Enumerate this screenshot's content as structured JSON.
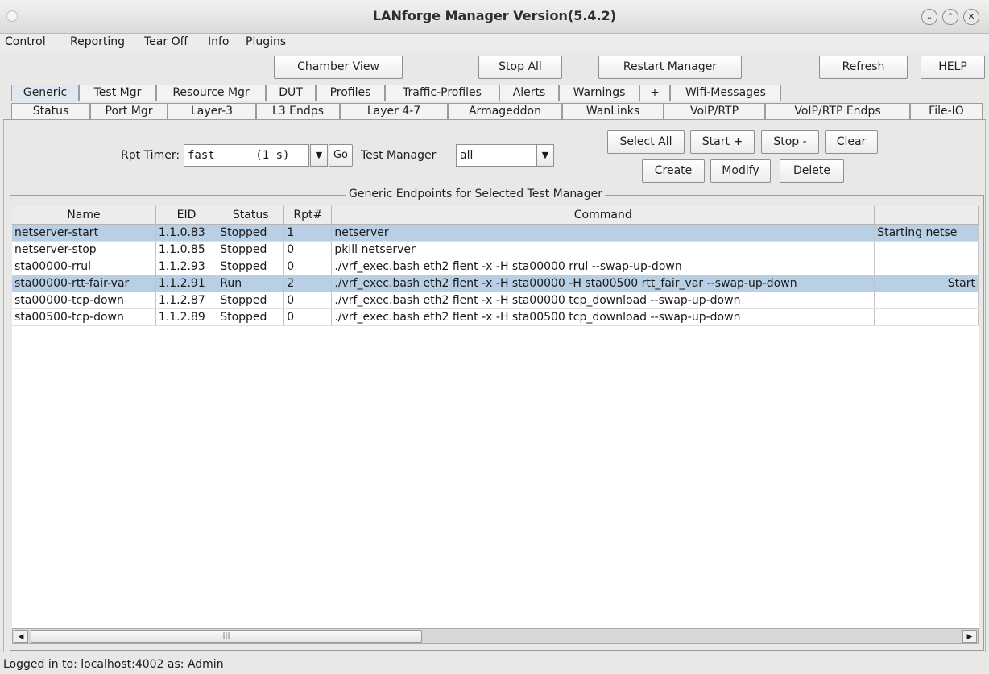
{
  "window": {
    "title": "LANforge Manager   Version(5.4.2)",
    "controls": [
      "minimize-icon",
      "maximize-icon",
      "close-icon"
    ]
  },
  "menu": [
    "Control",
    "Reporting",
    "Tear Off",
    "Info",
    "Plugins"
  ],
  "toolbar": {
    "chamber_view": "Chamber View",
    "stop_all": "Stop All",
    "restart_manager": "Restart Manager",
    "refresh": "Refresh",
    "help": "HELP"
  },
  "tabs_row1": [
    "Generic",
    "Test Mgr",
    "Resource Mgr",
    "DUT",
    "Profiles",
    "Traffic-Profiles",
    "Alerts",
    "Warnings",
    "+",
    "Wifi-Messages"
  ],
  "tabs_row2": [
    "Status",
    "Port Mgr",
    "Layer-3",
    "L3 Endps",
    "Layer 4-7",
    "Armageddon",
    "WanLinks",
    "VoIP/RTP",
    "VoIP/RTP Endps",
    "File-IO"
  ],
  "selected_tab": "Generic",
  "controls": {
    "rpt_timer_label": "Rpt Timer:",
    "rpt_timer_value": "fast      (1 s)",
    "go": "Go",
    "test_manager_label": "Test Manager",
    "test_manager_value": "all",
    "select_all": "Select All",
    "start": "Start +",
    "stop": "Stop -",
    "clear": "Clear",
    "create": "Create",
    "modify": "Modify",
    "delete": "Delete"
  },
  "group_title": "Generic Endpoints for Selected Test Manager",
  "table": {
    "columns": [
      "Name",
      "EID",
      "Status",
      "Rpt#",
      "Command",
      ""
    ],
    "rows": [
      {
        "name": "netserver-start",
        "eid": "1.1.0.83",
        "status": "Stopped",
        "rpt": "1",
        "command": "netserver",
        "extra": "Starting netse",
        "selected": true
      },
      {
        "name": "netserver-stop",
        "eid": "1.1.0.85",
        "status": "Stopped",
        "rpt": "0",
        "command": "pkill netserver",
        "extra": "",
        "selected": false
      },
      {
        "name": "sta00000-rrul",
        "eid": "1.1.2.93",
        "status": "Stopped",
        "rpt": "0",
        "command": "./vrf_exec.bash eth2 flent -x -H sta00000 rrul --swap-up-down",
        "extra": "",
        "selected": false
      },
      {
        "name": "sta00000-rtt-fair-var",
        "eid": "1.1.2.91",
        "status": "Run",
        "rpt": "2",
        "command": "./vrf_exec.bash eth2 flent -x -H sta00000 -H sta00500 rtt_fair_var --swap-up-down",
        "extra": "Start",
        "selected": true
      },
      {
        "name": "sta00000-tcp-down",
        "eid": "1.1.2.87",
        "status": "Stopped",
        "rpt": "0",
        "command": "./vrf_exec.bash eth2 flent -x -H sta00000 tcp_download --swap-up-down",
        "extra": "",
        "selected": false
      },
      {
        "name": "sta00500-tcp-down",
        "eid": "1.1.2.89",
        "status": "Stopped",
        "rpt": "0",
        "command": "./vrf_exec.bash eth2 flent -x -H sta00500 tcp_download --swap-up-down",
        "extra": "",
        "selected": false
      }
    ]
  },
  "statusbar": "Logged in to:  localhost:4002  as:  Admin"
}
